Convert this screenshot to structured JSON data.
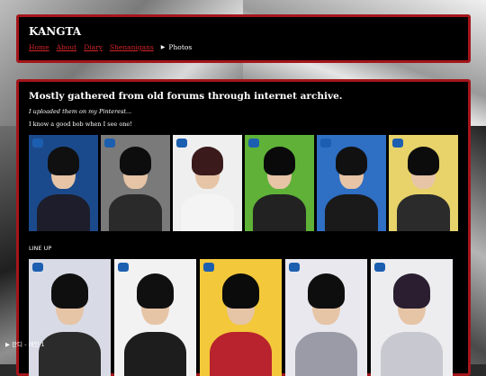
{
  "header": {
    "title": "KANGTA",
    "nav": [
      {
        "label": "Home"
      },
      {
        "label": "About"
      },
      {
        "label": "Diary"
      },
      {
        "label": "Shenanigans"
      }
    ],
    "current": "Photos",
    "current_marker": "▶"
  },
  "main": {
    "title": "Mostly gathered from old forums through internet archive.",
    "note_italic": "I uploaded them on my Pinterest...",
    "note": "I know a good bob when I see one!",
    "row1_photos": [
      {
        "bg": "#1b4a8c",
        "hair": "#101010",
        "body": "#1d1d2b",
        "logo": "SM"
      },
      {
        "bg": "#7a7a7a",
        "hair": "#0d0d0d",
        "body": "#2a2a2a",
        "logo": "SM"
      },
      {
        "bg": "#efefef",
        "hair": "#3a1a1a",
        "body": "#f4f4f4",
        "logo": "SM"
      },
      {
        "bg": "#5fb237",
        "hair": "#0a0a0a",
        "body": "#222222",
        "logo": "SM"
      },
      {
        "bg": "#2f6fc4",
        "hair": "#111111",
        "body": "#1a1a1a",
        "logo": "SM"
      },
      {
        "bg": "#e7d36a",
        "hair": "#0c0c0c",
        "body": "#2b2b2b",
        "logo": "SM"
      }
    ],
    "lineup_label": "LINE UP",
    "lineup_photos": [
      {
        "bg": "#d8dbe6",
        "hair": "#0f0f0f",
        "body": "#2b2b2b",
        "logo": "SM"
      },
      {
        "bg": "#f2f2f2",
        "hair": "#101010",
        "body": "#1d1d1d",
        "logo": "SM"
      },
      {
        "bg": "#f3c83b",
        "hair": "#0b0b0b",
        "body": "#b8232d",
        "logo": "SM"
      },
      {
        "bg": "#e8e8ee",
        "hair": "#0e0e0e",
        "body": "#9b9ba8",
        "logo": "SM"
      },
      {
        "bg": "#ededf0",
        "hair": "#2a1e30",
        "body": "#c8c8d0",
        "logo": "SM"
      }
    ]
  },
  "footer": {
    "widget_label": "▶ 란디 - 레인 1"
  },
  "colors": {
    "accent": "#a3161b",
    "link": "#d4252a"
  }
}
